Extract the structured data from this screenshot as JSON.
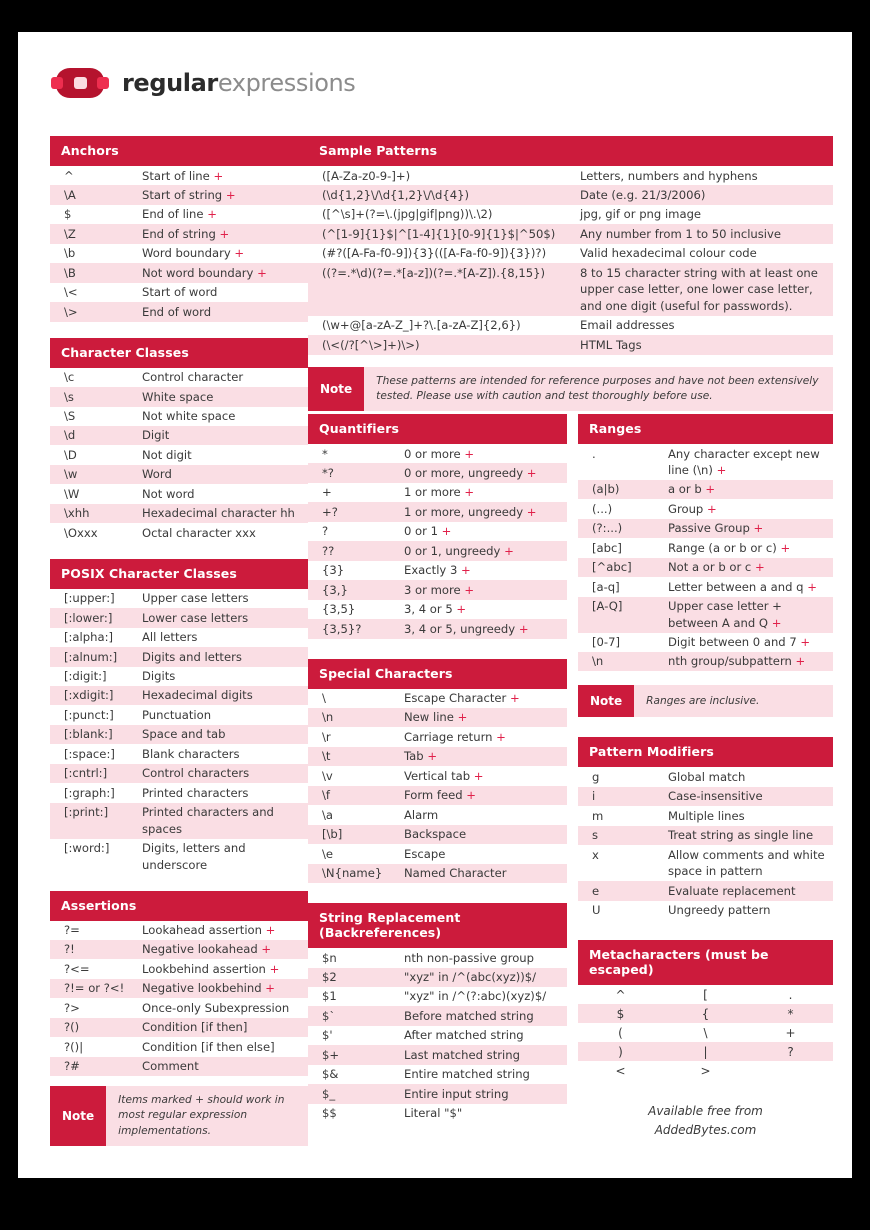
{
  "logo": {
    "part1": "regular",
    "part2": "expressions"
  },
  "footer": {
    "line1": "Available free from",
    "line2": "AddedBytes.com"
  },
  "colors": {
    "header": "#CC1B3C",
    "alt_row": "#FADEE4",
    "plus": "#E0214A"
  },
  "blocks": {
    "anchors": {
      "title": "Anchors",
      "rows": [
        {
          "sym": "^",
          "desc": "Start of line ",
          "plus": "+"
        },
        {
          "sym": "\\A",
          "desc": "Start of string ",
          "plus": "+"
        },
        {
          "sym": "$",
          "desc": "End of line ",
          "plus": "+"
        },
        {
          "sym": "\\Z",
          "desc": "End of string ",
          "plus": "+"
        },
        {
          "sym": "\\b",
          "desc": "Word boundary ",
          "plus": "+"
        },
        {
          "sym": "\\B",
          "desc": "Not word boundary ",
          "plus": "+"
        },
        {
          "sym": "\\<",
          "desc": "Start of word",
          "plus": ""
        },
        {
          "sym": "\\>",
          "desc": "End of word",
          "plus": ""
        }
      ]
    },
    "character_classes": {
      "title": "Character Classes",
      "rows": [
        {
          "sym": "\\c",
          "desc": "Control character",
          "plus": ""
        },
        {
          "sym": "\\s",
          "desc": "White space",
          "plus": ""
        },
        {
          "sym": "\\S",
          "desc": "Not white space",
          "plus": ""
        },
        {
          "sym": "\\d",
          "desc": "Digit",
          "plus": ""
        },
        {
          "sym": "\\D",
          "desc": "Not digit",
          "plus": ""
        },
        {
          "sym": "\\w",
          "desc": "Word",
          "plus": ""
        },
        {
          "sym": "\\W",
          "desc": "Not word",
          "plus": ""
        },
        {
          "sym": "\\xhh",
          "desc": "Hexadecimal character hh",
          "plus": ""
        },
        {
          "sym": "\\Oxxx",
          "desc": "Octal character xxx",
          "plus": ""
        }
      ]
    },
    "posix_character_classes": {
      "title": "POSIX Character Classes",
      "rows": [
        {
          "sym": "[:upper:]",
          "desc": "Upper case letters",
          "plus": ""
        },
        {
          "sym": "[:lower:]",
          "desc": "Lower case letters",
          "plus": ""
        },
        {
          "sym": "[:alpha:]",
          "desc": "All letters",
          "plus": ""
        },
        {
          "sym": "[:alnum:]",
          "desc": "Digits and letters",
          "plus": ""
        },
        {
          "sym": "[:digit:]",
          "desc": "Digits",
          "plus": ""
        },
        {
          "sym": "[:xdigit:]",
          "desc": "Hexadecimal digits",
          "plus": ""
        },
        {
          "sym": "[:punct:]",
          "desc": "Punctuation",
          "plus": ""
        },
        {
          "sym": "[:blank:]",
          "desc": "Space and tab",
          "plus": ""
        },
        {
          "sym": "[:space:]",
          "desc": "Blank characters",
          "plus": ""
        },
        {
          "sym": "[:cntrl:]",
          "desc": "Control characters",
          "plus": ""
        },
        {
          "sym": "[:graph:]",
          "desc": "Printed characters",
          "plus": ""
        },
        {
          "sym": "[:print:]",
          "desc": "Printed characters and spaces",
          "plus": ""
        },
        {
          "sym": "[:word:]",
          "desc": "Digits, letters and underscore",
          "plus": ""
        }
      ]
    },
    "assertions": {
      "title": "Assertions",
      "rows": [
        {
          "sym": "?=",
          "desc": "Lookahead assertion ",
          "plus": "+"
        },
        {
          "sym": "?!",
          "desc": "Negative lookahead ",
          "plus": "+"
        },
        {
          "sym": "?<=",
          "desc": "Lookbehind assertion ",
          "plus": "+"
        },
        {
          "sym": "?!= or ?<!",
          "desc": "Negative lookbehind ",
          "plus": "+"
        },
        {
          "sym": "?>",
          "desc": "Once-only Subexpression",
          "plus": ""
        },
        {
          "sym": "?()",
          "desc": "Condition [if then]",
          "plus": ""
        },
        {
          "sym": "?()|",
          "desc": "Condition [if then else]",
          "plus": ""
        },
        {
          "sym": "?#",
          "desc": "Comment",
          "plus": ""
        }
      ],
      "note": {
        "label": "Note",
        "text": "Items marked + should work in most regular expression implementations."
      }
    },
    "sample_patterns": {
      "title": "Sample Patterns",
      "rows": [
        {
          "pattern": "([A-Za-z0-9-]+)",
          "desc": "Letters, numbers and hyphens"
        },
        {
          "pattern": "(\\d{1,2}\\/\\d{1,2}\\/\\d{4})",
          "desc": "Date (e.g. 21/3/2006)"
        },
        {
          "pattern": "([^\\s]+(?=\\.(jpg|gif|png))\\.\\2)",
          "desc": "jpg, gif or png image"
        },
        {
          "pattern": "(^[1-9]{1}$|^[1-4]{1}[0-9]{1}$|^50$)",
          "desc": "Any number from 1 to 50 inclusive"
        },
        {
          "pattern": "(#?([A-Fa-f0-9]){3}(([A-Fa-f0-9]){3})?)",
          "desc": "Valid hexadecimal colour code"
        },
        {
          "pattern": "((?=.*\\d)(?=.*[a-z])(?=.*[A-Z]).{8,15})",
          "desc": "8 to 15 character string with at least one upper case letter, one lower case letter, and one digit (useful for passwords)."
        },
        {
          "pattern": "(\\w+@[a-zA-Z_]+?\\.[a-zA-Z]{2,6})",
          "desc": "Email addresses"
        },
        {
          "pattern": "(\\<(/?[^\\>]+)\\>)",
          "desc": "HTML Tags"
        }
      ],
      "note": {
        "label": "Note",
        "text": "These patterns are intended for reference purposes and have not been extensively tested. Please use with caution and test thoroughly before use."
      }
    },
    "quantifiers": {
      "title": "Quantifiers",
      "rows": [
        {
          "sym": "*",
          "desc": "0 or more ",
          "plus": "+"
        },
        {
          "sym": "*?",
          "desc": "0 or more, ungreedy ",
          "plus": "+"
        },
        {
          "sym": "+",
          "desc": "1 or more ",
          "plus": "+"
        },
        {
          "sym": "+?",
          "desc": "1 or more, ungreedy ",
          "plus": "+"
        },
        {
          "sym": "?",
          "desc": "0 or 1 ",
          "plus": "+"
        },
        {
          "sym": "??",
          "desc": "0 or 1, ungreedy ",
          "plus": "+"
        },
        {
          "sym": "{3}",
          "desc": "Exactly 3 ",
          "plus": "+"
        },
        {
          "sym": "{3,}",
          "desc": "3 or more ",
          "plus": "+"
        },
        {
          "sym": "{3,5}",
          "desc": "3, 4 or 5 ",
          "plus": "+"
        },
        {
          "sym": "{3,5}?",
          "desc": "3, 4 or 5, ungreedy ",
          "plus": "+"
        }
      ]
    },
    "special_characters": {
      "title": "Special Characters",
      "rows": [
        {
          "sym": "\\",
          "desc": "Escape Character ",
          "plus": "+"
        },
        {
          "sym": "\\n",
          "desc": "New line ",
          "plus": "+"
        },
        {
          "sym": "\\r",
          "desc": "Carriage return ",
          "plus": "+"
        },
        {
          "sym": "\\t",
          "desc": "Tab ",
          "plus": "+"
        },
        {
          "sym": "\\v",
          "desc": "Vertical tab ",
          "plus": "+"
        },
        {
          "sym": "\\f",
          "desc": "Form feed ",
          "plus": "+"
        },
        {
          "sym": "\\a",
          "desc": "Alarm",
          "plus": ""
        },
        {
          "sym": "[\\b]",
          "desc": "Backspace",
          "plus": ""
        },
        {
          "sym": "\\e",
          "desc": "Escape",
          "plus": ""
        },
        {
          "sym": "\\N{name}",
          "desc": "Named Character",
          "plus": ""
        }
      ]
    },
    "string_replacement": {
      "title": "String Replacement (Backreferences)",
      "rows": [
        {
          "sym": "$n",
          "desc": "nth non-passive group",
          "plus": ""
        },
        {
          "sym": "$2",
          "desc": "\"xyz\" in /^(abc(xyz))$/",
          "plus": ""
        },
        {
          "sym": "$1",
          "desc": "\"xyz\" in /^(?:abc)(xyz)$/",
          "plus": ""
        },
        {
          "sym": "$`",
          "desc": "Before matched string",
          "plus": ""
        },
        {
          "sym": "$'",
          "desc": "After matched string",
          "plus": ""
        },
        {
          "sym": "$+",
          "desc": "Last matched string",
          "plus": ""
        },
        {
          "sym": "$&",
          "desc": "Entire matched string",
          "plus": ""
        },
        {
          "sym": "$_",
          "desc": "Entire input string",
          "plus": ""
        },
        {
          "sym": "$$",
          "desc": "Literal \"$\"",
          "plus": ""
        }
      ]
    },
    "ranges": {
      "title": "Ranges",
      "rows": [
        {
          "sym": ".",
          "desc": "Any character except new line (\\n) ",
          "plus": "+"
        },
        {
          "sym": "(a|b)",
          "desc": "a or b ",
          "plus": "+"
        },
        {
          "sym": "(...)",
          "desc": "Group ",
          "plus": "+"
        },
        {
          "sym": "(?:...)",
          "desc": "Passive Group ",
          "plus": "+"
        },
        {
          "sym": "[abc]",
          "desc": "Range (a or b or c) ",
          "plus": "+"
        },
        {
          "sym": "[^abc]",
          "desc": "Not a or b or c ",
          "plus": "+"
        },
        {
          "sym": "[a-q]",
          "desc": "Letter between a and q ",
          "plus": "+"
        },
        {
          "sym": "[A-Q]",
          "desc": "Upper case letter + between A and Q ",
          "plus": "+"
        },
        {
          "sym": "[0-7]",
          "desc": "Digit between 0 and 7 ",
          "plus": "+"
        },
        {
          "sym": "\\n",
          "desc": "nth group/subpattern ",
          "plus": "+"
        }
      ],
      "note": {
        "label": "Note",
        "text": "Ranges are inclusive."
      }
    },
    "pattern_modifiers": {
      "title": "Pattern Modifiers",
      "rows": [
        {
          "sym": "g",
          "desc": "Global match",
          "plus": ""
        },
        {
          "sym": "i",
          "desc": "Case-insensitive",
          "plus": ""
        },
        {
          "sym": "m",
          "desc": "Multiple lines",
          "plus": ""
        },
        {
          "sym": "s",
          "desc": "Treat string as single line",
          "plus": ""
        },
        {
          "sym": "x",
          "desc": "Allow comments and white space in pattern",
          "plus": ""
        },
        {
          "sym": "e",
          "desc": "Evaluate replacement",
          "plus": ""
        },
        {
          "sym": "U",
          "desc": "Ungreedy pattern",
          "plus": ""
        }
      ]
    },
    "metacharacters": {
      "title": "Metacharacters (must be escaped)",
      "rows": [
        [
          "^",
          "[",
          "."
        ],
        [
          "$",
          "{",
          "*"
        ],
        [
          "(",
          "\\",
          "+"
        ],
        [
          ")",
          "|",
          "?"
        ],
        [
          "<",
          ">",
          ""
        ]
      ]
    }
  }
}
